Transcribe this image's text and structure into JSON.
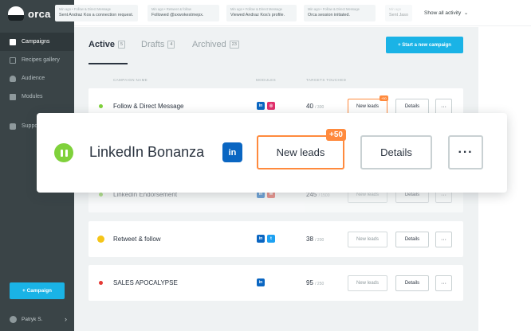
{
  "app": {
    "name": "orca"
  },
  "sidebar": {
    "items": [
      {
        "label": "Campaigns",
        "icon": "folder-icon",
        "active": true
      },
      {
        "label": "Recipes gallery",
        "icon": "layers-icon",
        "active": false
      },
      {
        "label": "Audience",
        "icon": "user-icon",
        "active": false
      },
      {
        "label": "Modules",
        "icon": "module-icon",
        "active": false
      },
      {
        "label": "Suppo",
        "icon": "chat-icon",
        "active": false
      }
    ],
    "campaign_button": "+ Campaign",
    "user": {
      "name": "Patryk S."
    }
  },
  "activity": {
    "items": [
      {
        "time": "Min ago • Follow & Direct Message",
        "text": "Sent Andraz Kos a connection request."
      },
      {
        "time": "Min ago • Retweet & follow",
        "text": "Followed @sxwokestmepx."
      },
      {
        "time": "Min ago • Follow & Direct Message",
        "text": "Viewed Andraz Kos's profile."
      },
      {
        "time": "Min ago • Follow & Direct Message",
        "text": "Orca session initiated."
      },
      {
        "time": "Min ago",
        "text": "Sent Jaso"
      }
    ],
    "show_all": "Show all activity"
  },
  "tabs": [
    {
      "label": "Active",
      "count": "5",
      "active": true
    },
    {
      "label": "Drafts",
      "count": "4",
      "active": false
    },
    {
      "label": "Archived",
      "count": "23",
      "active": false
    }
  ],
  "start_button": "+ Start a new campaign",
  "columns": {
    "name": "CAMPAIGN NAME",
    "modules": "MODULES",
    "targets": "TARGETS TOUCHED"
  },
  "rows": [
    {
      "name": "Follow & Direct Message",
      "status_color": "#7fd13b",
      "modules": [
        "in",
        "ig"
      ],
      "touched": "40",
      "total": "/ 300",
      "leads": "New leads",
      "leads_badge": "+50",
      "details": "Details",
      "more": "···"
    },
    {
      "name": "LinkedIn Endorsement",
      "status_color": "#7fd13b",
      "modules": [
        "in",
        "mail"
      ],
      "touched": "245",
      "total": "/ 1500",
      "leads": "New leads",
      "details": "Details",
      "more": "···"
    },
    {
      "name": "Retweet & follow",
      "status_color": "#f5c518",
      "modules": [
        "in",
        "tw"
      ],
      "touched": "38",
      "total": "/ 200",
      "leads": "New leads",
      "details": "Details",
      "more": "···"
    },
    {
      "name": "SALES APOCALYPSE",
      "status_color": "#e53935",
      "modules": [
        "in"
      ],
      "touched": "95",
      "total": "/ 250",
      "leads": "New leads",
      "details": "Details",
      "more": "···"
    }
  ],
  "zoom": {
    "name": "LinkedIn Bonanza",
    "module": "in",
    "leads": "New leads",
    "leads_badge": "+50",
    "details": "Details",
    "more": "···"
  }
}
